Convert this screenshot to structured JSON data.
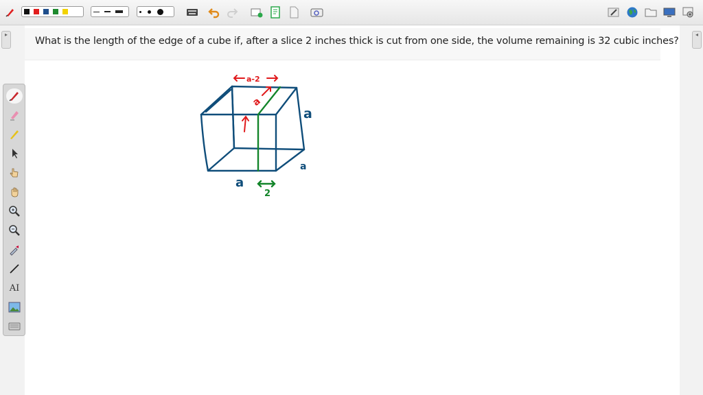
{
  "question": {
    "text": "What is the length of the edge of a cube if, after a slice 2 inches thick is cut from one side, the volume remaining is 32 cubic inches?"
  },
  "toolbar": {
    "icons": [
      "pen-settings-icon",
      "color-palette",
      "line-style-group",
      "dot-size-group",
      "keyboard-icon",
      "undo-icon",
      "redo-icon",
      "add-page-icon",
      "page-icon",
      "blank-page-icon",
      "screenshot-icon",
      "edit-icon",
      "globe-icon",
      "folder-icon",
      "display-icon",
      "settings-icon"
    ],
    "colors": [
      "#111111",
      "#e11d1d",
      "#1f4e8c",
      "#1e8a2e",
      "#f2d200"
    ]
  },
  "palette": {
    "tools": [
      "pen-icon",
      "highlighter-icon",
      "marker-icon",
      "pointer-icon",
      "hand-pointer-icon",
      "hand-icon",
      "zoom-in-icon",
      "zoom-out-icon",
      "eyedropper-icon",
      "line-icon",
      "text-icon",
      "image-icon",
      "keyboard-icon"
    ],
    "text_tool_label": "AI"
  },
  "drawing": {
    "label_a_top_right": "a",
    "label_a_bottom_right": "a",
    "label_a_bottom_left": "a",
    "label_top_dimension": "←a-2→",
    "label_slice_dimension": "2",
    "label_depth": "a",
    "colors": {
      "cube": "#0f4d7a",
      "annotation_red": "#e0191b",
      "annotation_green": "#13852a"
    }
  }
}
